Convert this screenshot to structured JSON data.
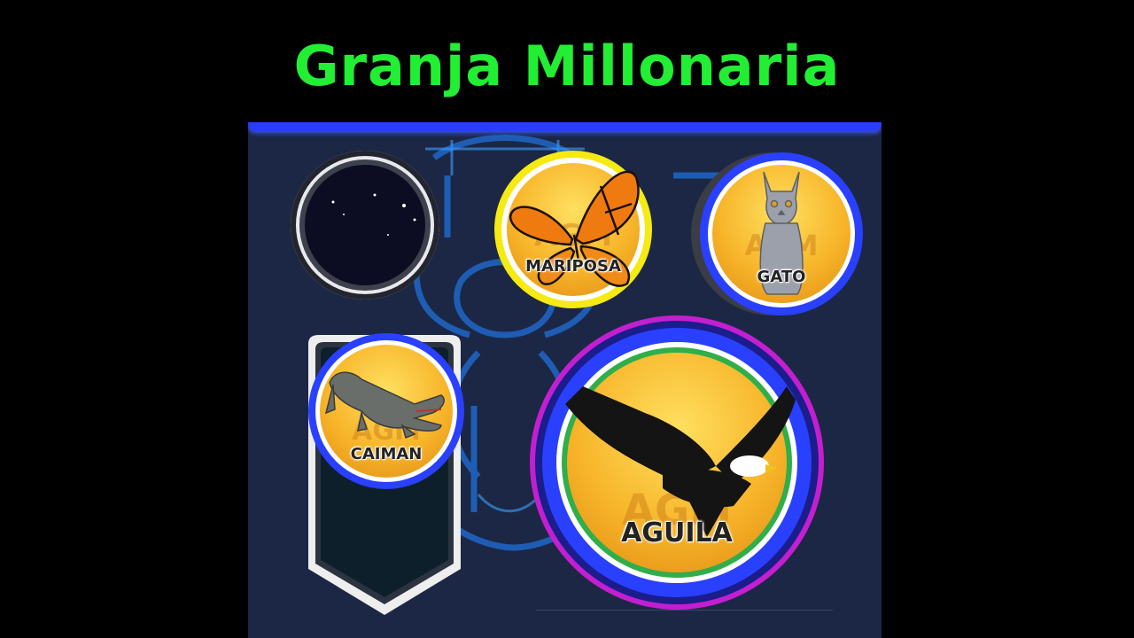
{
  "header": {
    "title": "Granja Millonaria"
  },
  "badges": {
    "empty": {
      "name": "empty-slot"
    },
    "mariposa": {
      "label": "MARIPOSA",
      "watermark": "AGM"
    },
    "gato": {
      "label": "GATO",
      "watermark": "AGM"
    },
    "caiman": {
      "label": "CAIMAN",
      "watermark": "AGM"
    },
    "aguila": {
      "label": "AGUILA",
      "watermark": "AGM"
    }
  },
  "colors": {
    "title": "#22ee33",
    "panel": "#1b2744",
    "accent_blue": "#2a3dff",
    "highlight_yellow": "#f5ea12",
    "highlight_magenta": "#c21fd0"
  }
}
